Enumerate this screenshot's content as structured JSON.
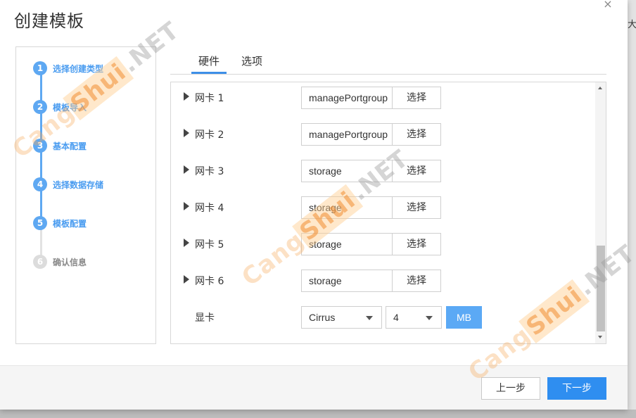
{
  "dialog": {
    "title": "创建模板",
    "close_glyph": "×"
  },
  "background": {
    "edge_text": "大小"
  },
  "steps": [
    {
      "number": "1",
      "label": "选择创建类型",
      "state": "done"
    },
    {
      "number": "2",
      "label": "模板导入",
      "state": "done"
    },
    {
      "number": "3",
      "label": "基本配置",
      "state": "done"
    },
    {
      "number": "4",
      "label": "选择数据存储",
      "state": "done"
    },
    {
      "number": "5",
      "label": "模板配置",
      "state": "current"
    },
    {
      "number": "6",
      "label": "确认信息",
      "state": "pending"
    }
  ],
  "tabs": [
    {
      "label": "硬件",
      "active": true
    },
    {
      "label": "选项",
      "active": false
    }
  ],
  "nics": [
    {
      "label": "网卡 1",
      "value": "managePortgroup",
      "button": "选择"
    },
    {
      "label": "网卡 2",
      "value": "managePortgroup",
      "button": "选择"
    },
    {
      "label": "网卡 3",
      "value": "storage",
      "button": "选择"
    },
    {
      "label": "网卡 4",
      "value": "storage",
      "button": "选择"
    },
    {
      "label": "网卡 5",
      "value": "storage",
      "button": "选择"
    },
    {
      "label": "网卡 6",
      "value": "storage",
      "button": "选择"
    }
  ],
  "video": {
    "label": "显卡",
    "adapter": "Cirrus",
    "memory": "4",
    "unit": "MB"
  },
  "footer": {
    "prev_label": "上一步",
    "next_label": "下一步"
  },
  "watermark": {
    "pre": "Cang",
    "mid": "Shui",
    "post": ".NET"
  },
  "colors": {
    "accent": "#2f8ef0",
    "step_active": "#5ea8f2",
    "unit_button": "#5ba9f5"
  }
}
